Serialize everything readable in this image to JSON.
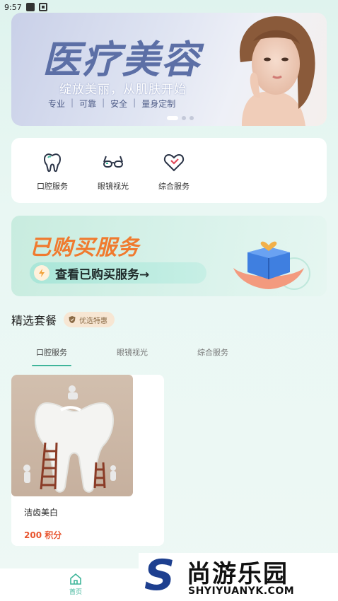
{
  "status_bar": {
    "time": "9:57"
  },
  "banner": {
    "title": "医疗美容",
    "subtitle": "绽放美丽，从肌肤开始",
    "tags": [
      "专业",
      "可靠",
      "安全",
      "量身定制"
    ]
  },
  "services": [
    {
      "label": "口腔服务",
      "icon": "tooth-icon"
    },
    {
      "label": "眼镜视光",
      "icon": "glasses-icon"
    },
    {
      "label": "综合服务",
      "icon": "heart-icon"
    }
  ],
  "purchased": {
    "title": "已购买服务",
    "button_label": "查看已购买服务→"
  },
  "section": {
    "title": "精选套餐",
    "badge": "优选特惠"
  },
  "tabs": [
    "口腔服务",
    "眼镜视光",
    "综合服务"
  ],
  "active_tab": "口腔服务",
  "product": {
    "name": "洁齿美白",
    "price": "200 积分"
  },
  "bottom_nav": {
    "home_label": "首页"
  },
  "watermark": {
    "brand_cn": "尚游乐园",
    "brand_en": "SHYIYUANYK.COM"
  },
  "colors": {
    "accent": "#3fb59a",
    "price": "#e8552f",
    "purchased_title": "#f07a2e"
  }
}
